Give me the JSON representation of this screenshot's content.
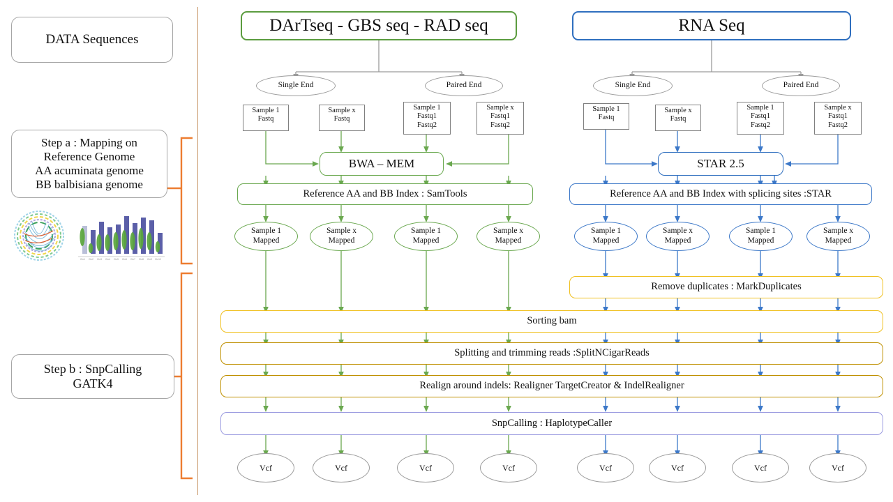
{
  "meta": {
    "title": "Variant calling workflow: DArTseq/GBS/RAD-seq and RNA-Seq",
    "colors": {
      "green": "#6aa84f",
      "blue": "#3c78c8",
      "gold": "#f0c020",
      "dark_gold": "#bf9000",
      "purple": "#9a9ae0",
      "orange_bracket": "#ed7d31",
      "gray_border": "#a6a6a6",
      "divider": "#c9996b"
    }
  },
  "sidebar": {
    "data_box": {
      "label": "DATA Sequences"
    },
    "step_a": {
      "lines": [
        "Step a : Mapping on",
        "Reference Genome",
        "AA acuminata genome",
        "BB balbisiana genome"
      ]
    },
    "step_b": {
      "lines": [
        "Step b : SnpCalling",
        "GATK4"
      ]
    },
    "figures": [
      {
        "name": "circos-plot-thumbnail"
      },
      {
        "name": "chromosome-density-plot-thumbnail"
      }
    ]
  },
  "pipelines": [
    {
      "id": "dartseq",
      "header": "DArTseq  -  GBS seq  - RAD seq",
      "accent": "green",
      "ends": [
        "Single  End",
        "Paired End"
      ],
      "samples": [
        {
          "lines": [
            "Sample 1",
            "Fastq"
          ]
        },
        {
          "lines": [
            "Sample x",
            "Fastq"
          ]
        },
        {
          "lines": [
            "Sample 1",
            "Fastq1",
            "Fastq2"
          ]
        },
        {
          "lines": [
            "Sample x",
            "Fastq1",
            "Fastq2"
          ]
        }
      ],
      "aligner": "BWA – MEM",
      "index": "Reference  AA and BB Index : SamTools",
      "mapped": [
        {
          "lines": [
            "Sample 1",
            "Mapped"
          ]
        },
        {
          "lines": [
            "Sample x",
            "Mapped"
          ]
        },
        {
          "lines": [
            "Sample 1",
            "Mapped"
          ]
        },
        {
          "lines": [
            "Sample x",
            "Mapped"
          ]
        }
      ],
      "outputs": [
        "Vcf",
        "Vcf",
        "Vcf",
        "Vcf"
      ]
    },
    {
      "id": "rnaseq",
      "header": "RNA Seq",
      "accent": "blue",
      "ends": [
        "Single  End",
        "Paired End"
      ],
      "samples": [
        {
          "lines": [
            "Sample 1",
            "Fastq"
          ]
        },
        {
          "lines": [
            "Sample x",
            "Fastq"
          ]
        },
        {
          "lines": [
            "Sample 1",
            "Fastq1",
            "Fastq2"
          ]
        },
        {
          "lines": [
            "Sample x",
            "Fastq1",
            "Fastq2"
          ]
        }
      ],
      "aligner": "STAR 2.5",
      "index": "Reference  AA and BB Index with  splicing  sites :STAR",
      "mapped": [
        {
          "lines": [
            "Sample 1",
            "Mapped"
          ]
        },
        {
          "lines": [
            "Sample x",
            "Mapped"
          ]
        },
        {
          "lines": [
            "Sample 1",
            "Mapped"
          ]
        },
        {
          "lines": [
            "Sample x",
            "Mapped"
          ]
        }
      ],
      "outputs": [
        "Vcf",
        "Vcf",
        "Vcf",
        "Vcf"
      ]
    }
  ],
  "shared_steps": {
    "remove_duplicates": "Remove duplicates :  MarkDuplicates",
    "sorting": "Sorting  bam",
    "splitting": "Splitting  and trimming  reads :SplitNCigarReads",
    "realign": "Realign  around indels:  Realigner  TargetCreator  &  IndelRealigner",
    "snpcalling": "SnpCalling  :  HaplotypeCaller"
  }
}
